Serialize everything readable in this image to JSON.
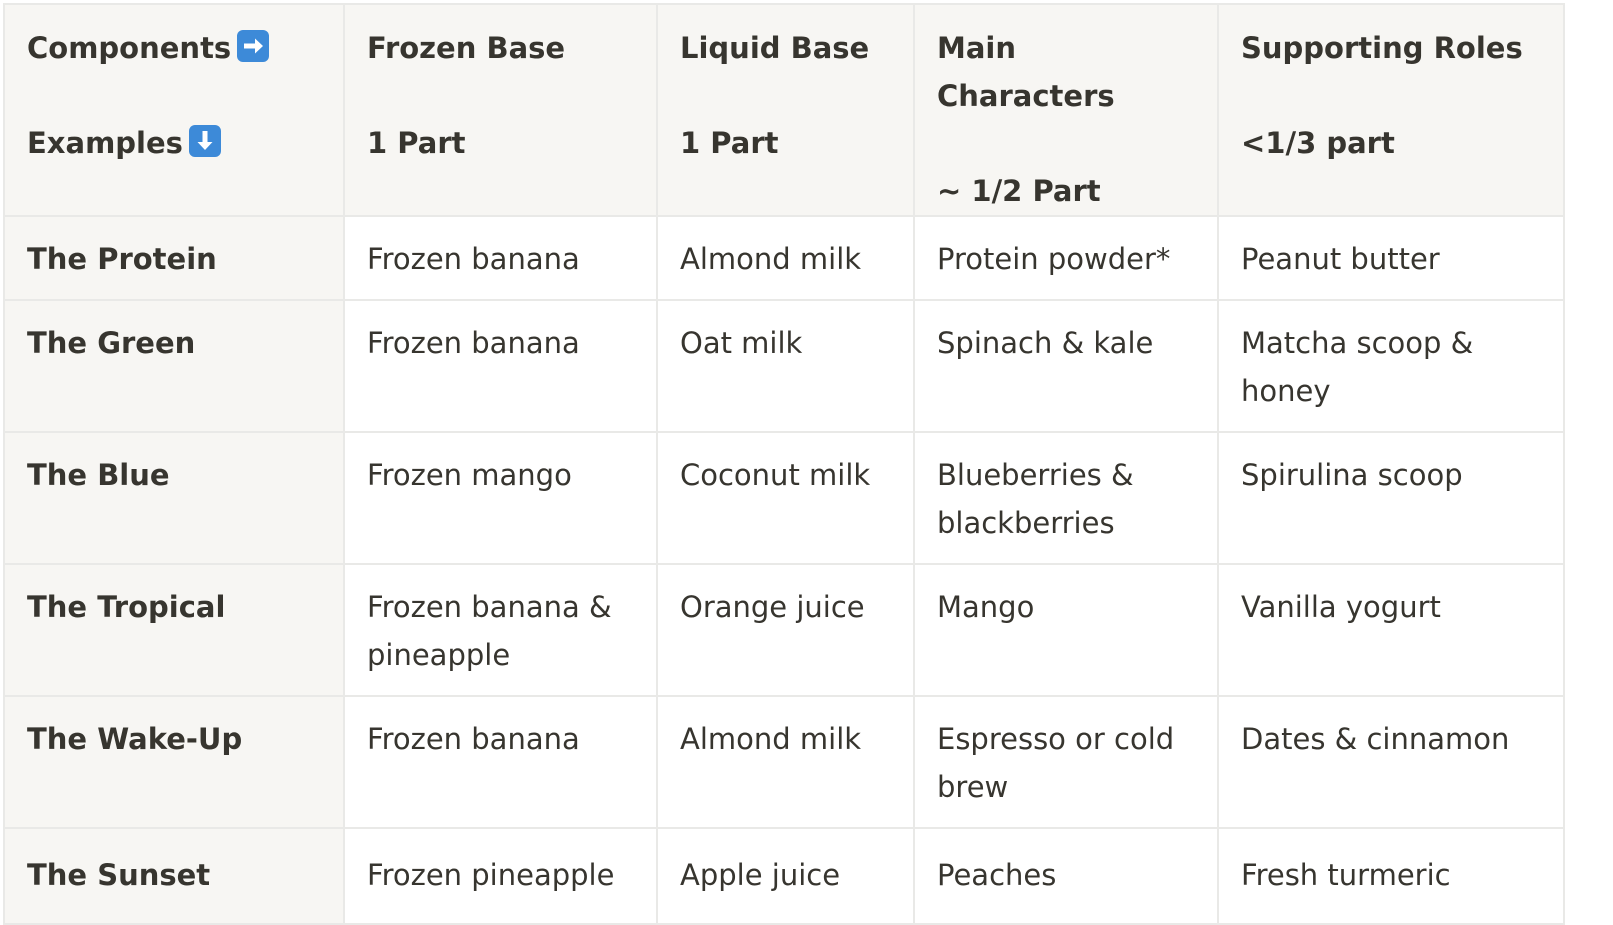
{
  "header": {
    "col0": {
      "line1": "Components",
      "line1_icon": "right-arrow-emoji-icon",
      "line2": "Examples",
      "line2_icon": "down-arrow-emoji-icon"
    },
    "col1": {
      "line1": "Frozen Base",
      "line2": "1 Part"
    },
    "col2": {
      "line1": "Liquid Base",
      "line2": "1 Part"
    },
    "col3": {
      "line1": "Main Characters",
      "line2": "~ 1/2 Part"
    },
    "col4": {
      "line1": "Supporting Roles",
      "line2": "<1/3 part"
    }
  },
  "rows": [
    {
      "name": "The Protein",
      "frozen": "Frozen banana",
      "liquid": "Almond milk",
      "main": "Protein powder*",
      "supporting": "Peanut butter"
    },
    {
      "name": "The Green",
      "frozen": "Frozen banana",
      "liquid": "Oat milk",
      "main": "Spinach & kale",
      "supporting": "Matcha scoop & honey"
    },
    {
      "name": "The Blue",
      "frozen": "Frozen mango",
      "liquid": "Coconut milk",
      "main": "Blueberries & blackberries",
      "supporting": "Spirulina scoop"
    },
    {
      "name": "The Tropical",
      "frozen": "Frozen banana & pineapple",
      "liquid": "Orange juice",
      "main": "Mango",
      "supporting": "Vanilla yogurt"
    },
    {
      "name": "The Wake-Up",
      "frozen": "Frozen banana",
      "liquid": "Almond milk",
      "main": "Espresso or cold brew",
      "supporting": "Dates & cinnamon"
    },
    {
      "name": "The Sunset",
      "frozen": "Frozen pineapple",
      "liquid": "Apple juice",
      "main": "Peaches",
      "supporting": "Fresh turmeric"
    }
  ],
  "colors": {
    "text": "#37352f",
    "header_bg": "#f7f6f3",
    "border": "#e9e9e7",
    "emoji_bg": "#3d8ad8"
  }
}
